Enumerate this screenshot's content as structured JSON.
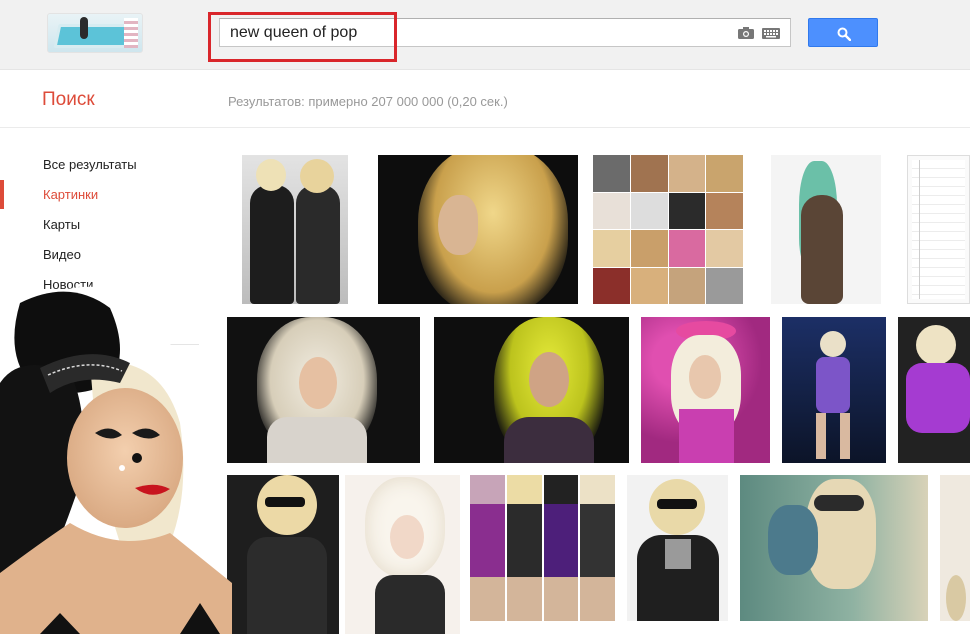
{
  "header": {
    "doodle_name": "google-doodle-logo",
    "search_value": "new queen of pop",
    "search_button_icon": "search-icon",
    "camera_icon": "camera-icon",
    "keyboard_icon": "keyboard-icon",
    "highlight_color": "#d9262b",
    "button_color": "#4d90fe"
  },
  "subheader": {
    "brand": "Поиск",
    "stats": "Результатов: примерно 207 000 000 (0,20 сек.)"
  },
  "nav": {
    "items": [
      {
        "label": "Все результаты",
        "active": false
      },
      {
        "label": "Картинки",
        "active": true
      },
      {
        "label": "Карты",
        "active": false
      },
      {
        "label": "Видео",
        "active": false
      },
      {
        "label": "Новости",
        "active": false
      }
    ],
    "accent_color": "#dd4b39"
  },
  "results": {
    "rows": 3
  }
}
